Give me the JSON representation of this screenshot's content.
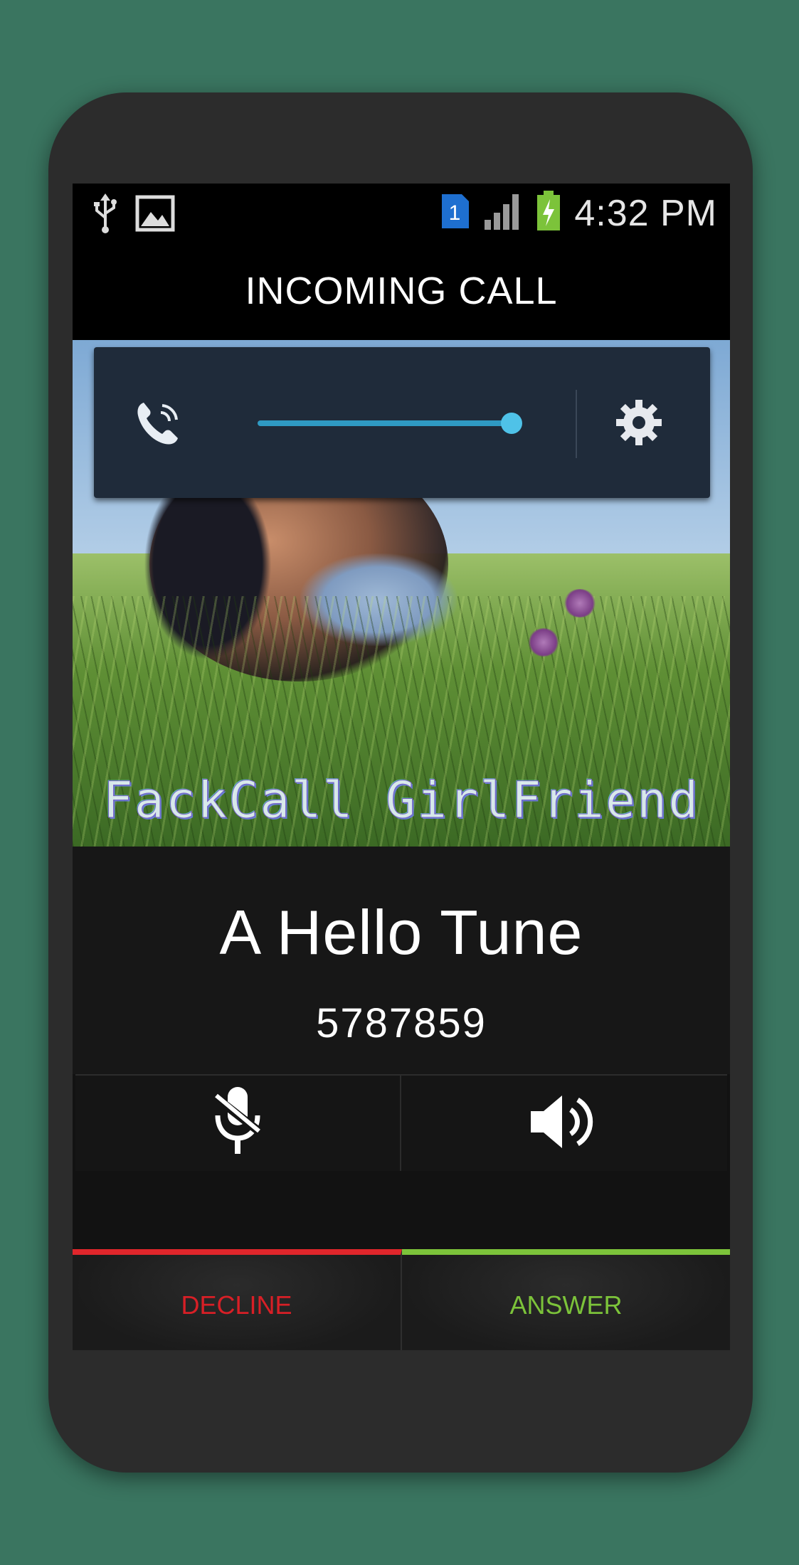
{
  "status_bar": {
    "time": "4:32 PM",
    "sim_badge": "1",
    "icons": [
      "usb-icon",
      "image-icon",
      "sim-icon",
      "signal-icon",
      "battery-charging-icon"
    ]
  },
  "header": {
    "title": "INCOMING CALL"
  },
  "photo": {
    "caption": "FackCall GirlFriend"
  },
  "volume_panel": {
    "level": 1.0,
    "icons": [
      "ringer-phone-icon",
      "settings-gear-icon"
    ],
    "accent_color": "#2f9ac3"
  },
  "caller": {
    "name": "A Hello Tune",
    "number": "5787859"
  },
  "controls": {
    "icons": [
      "mute-mic-icon",
      "speaker-icon"
    ]
  },
  "actions": {
    "decline_label": "DECLINE",
    "answer_label": "ANSWER",
    "decline_color": "#e0262b",
    "answer_color": "#7cc33a"
  }
}
